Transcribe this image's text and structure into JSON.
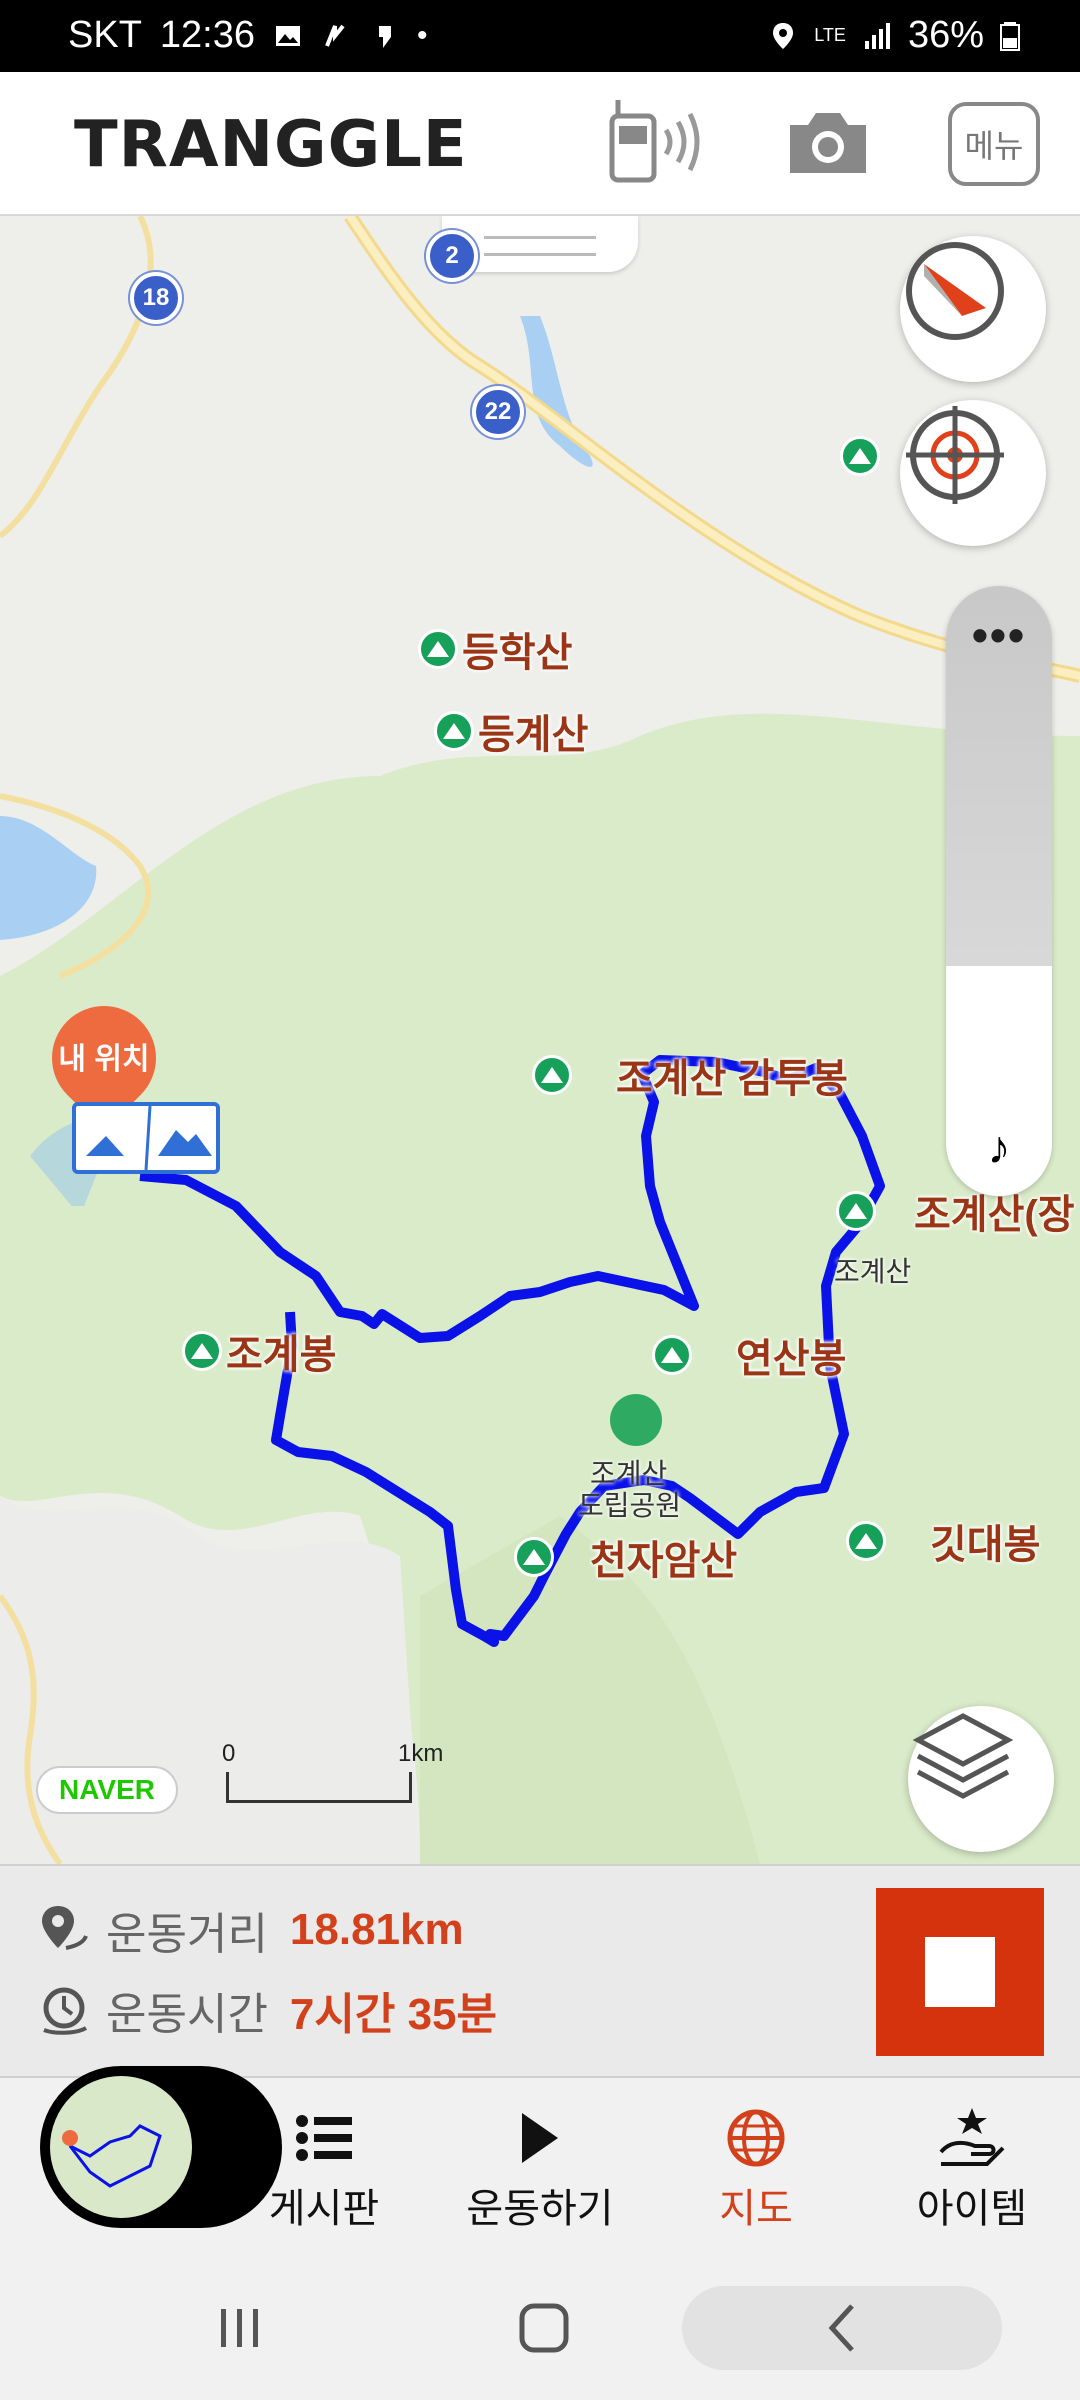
{
  "status_bar": {
    "carrier": "SKT",
    "time": "12:36",
    "battery": "36%",
    "network": "LTE"
  },
  "header": {
    "logo": "TRANGGLE",
    "menu_label": "메뉴",
    "icons": [
      "walkie-talkie-icon",
      "camera-icon"
    ]
  },
  "map": {
    "route_badges": [
      "18",
      "22",
      "2"
    ],
    "peaks": {
      "p1": "등학산",
      "p2": "등계산",
      "p3": "조계산 감투봉",
      "p4": "조계산(장",
      "p5": "조계봉",
      "p6": "연산봉",
      "p7": "천자암산",
      "p8": "깃대봉"
    },
    "small_labels": {
      "s1": "조계산",
      "s2": "조계산",
      "s3": "도립공원"
    },
    "my_location_label": "내 위치",
    "attribution": "NAVER",
    "scale": {
      "start": "0",
      "end": "1km"
    },
    "route_color": "#0a12e8"
  },
  "stats": {
    "distance_label": "운동거리",
    "distance_value": "18.81km",
    "time_label": "운동시간",
    "time_value": "7시간 35분",
    "accent_color": "#d2411b"
  },
  "bottom_nav": {
    "items": [
      {
        "label": "게시판",
        "icon": "list-icon"
      },
      {
        "label": "운동하기",
        "icon": "play-icon"
      },
      {
        "label": "지도",
        "icon": "globe-icon",
        "active": true
      },
      {
        "label": "아이템",
        "icon": "hand-star-icon"
      }
    ]
  }
}
